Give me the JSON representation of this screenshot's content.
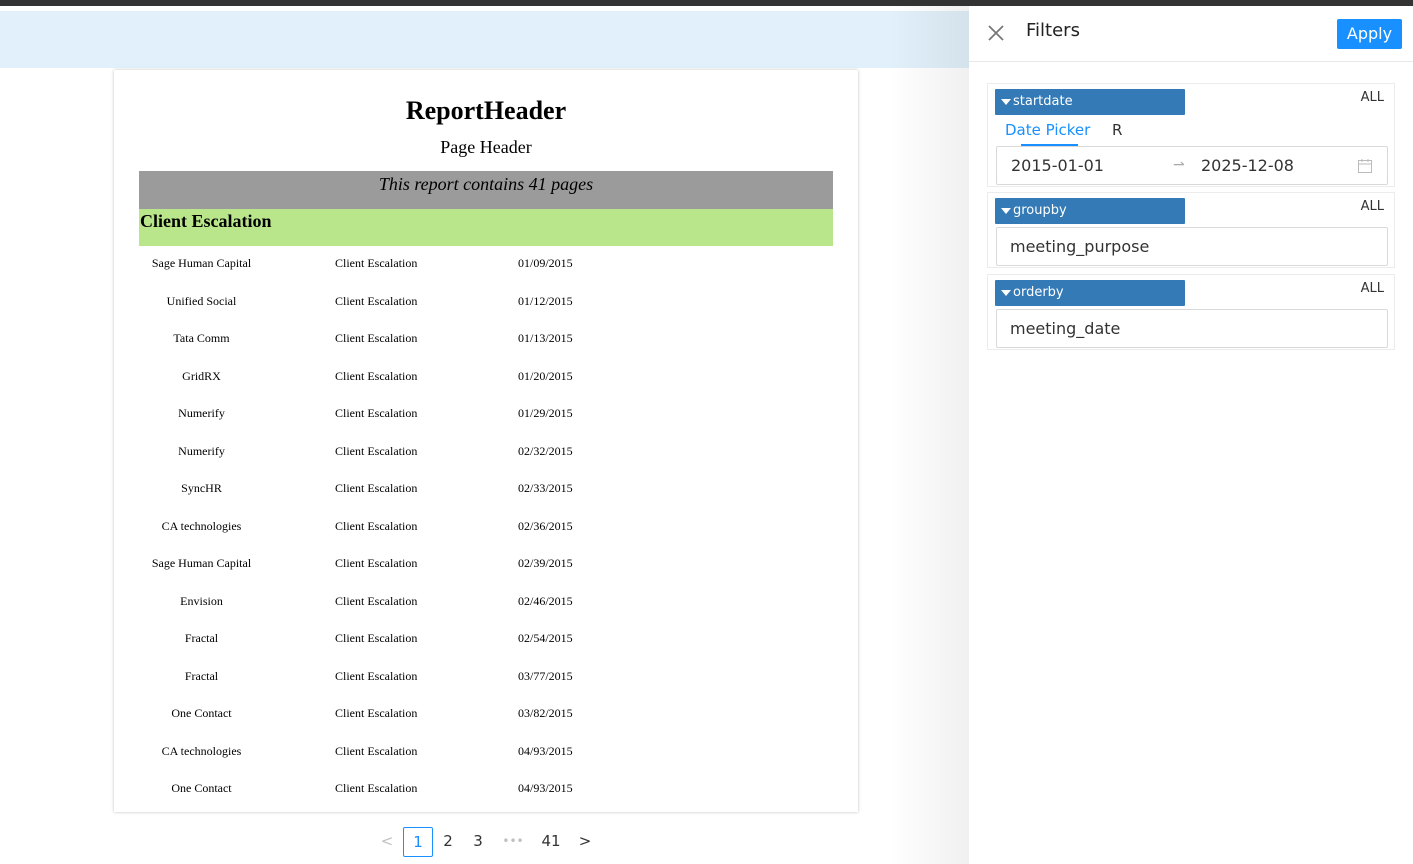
{
  "report": {
    "header": "ReportHeader",
    "page_header": "Page Header",
    "pages_notice": "This report contains 41 pages",
    "group_title": "Client Escalation",
    "rows": [
      [
        "Sage Human Capital",
        "Client Escalation",
        "01/09/2015"
      ],
      [
        "Unified Social",
        "Client Escalation",
        "01/12/2015"
      ],
      [
        "Tata Comm",
        "Client Escalation",
        "01/13/2015"
      ],
      [
        "GridRX",
        "Client Escalation",
        "01/20/2015"
      ],
      [
        "Numerify",
        "Client Escalation",
        "01/29/2015"
      ],
      [
        "Numerify",
        "Client Escalation",
        "02/32/2015"
      ],
      [
        "SyncHR",
        "Client Escalation",
        "02/33/2015"
      ],
      [
        "CA technologies",
        "Client Escalation",
        "02/36/2015"
      ],
      [
        "Sage Human Capital",
        "Client Escalation",
        "02/39/2015"
      ],
      [
        "Envision",
        "Client Escalation",
        "02/46/2015"
      ],
      [
        "Fractal",
        "Client Escalation",
        "02/54/2015"
      ],
      [
        "Fractal",
        "Client Escalation",
        "03/77/2015"
      ],
      [
        "One Contact",
        "Client Escalation",
        "03/82/2015"
      ],
      [
        "CA technologies",
        "Client Escalation",
        "04/93/2015"
      ],
      [
        "One Contact",
        "Client Escalation",
        "04/93/2015"
      ]
    ]
  },
  "pager": {
    "prev": "<",
    "pages": [
      "1",
      "2",
      "3"
    ],
    "ellipsis": "•••",
    "last": "41",
    "next": ">",
    "current": "1"
  },
  "filters": {
    "title": "Filters",
    "apply_label": "Apply",
    "items": [
      {
        "name": "startdate",
        "all_label": "ALL",
        "tabs": [
          "Date Picker",
          "R"
        ],
        "start": "2015-01-01",
        "end": "2025-12-08"
      },
      {
        "name": "groupby",
        "all_label": "ALL",
        "value": "meeting_purpose"
      },
      {
        "name": "orderby",
        "all_label": "ALL",
        "value": "meeting_date"
      }
    ]
  },
  "colors": {
    "accent": "#1890ff",
    "tag_blue": "#337ab7",
    "toolbar_band": "#e1f0fa",
    "group_green": "#b9e68a",
    "notice_gray": "#9b9b9b"
  }
}
